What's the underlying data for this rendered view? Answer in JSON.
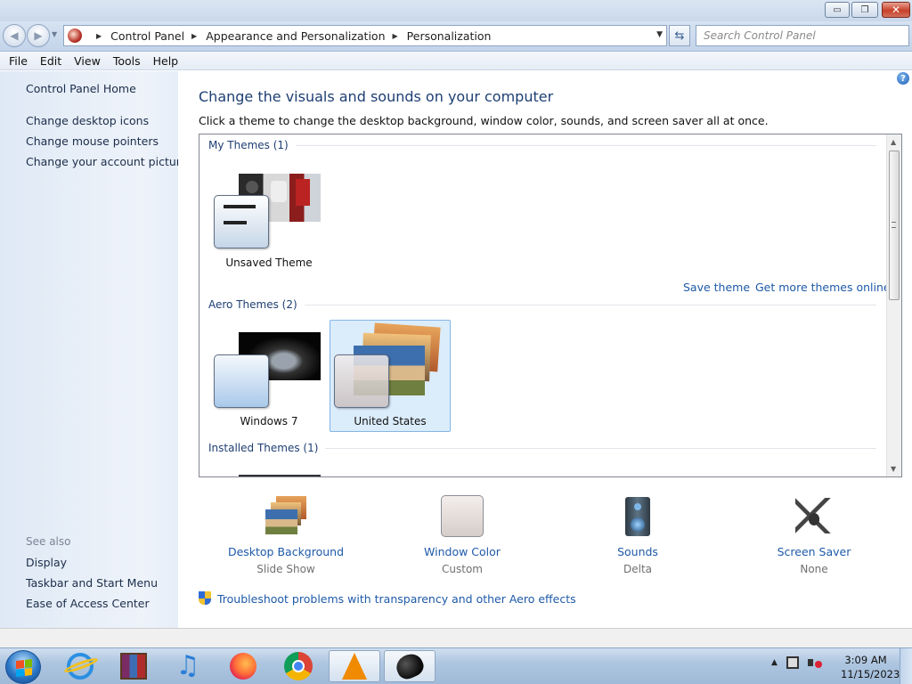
{
  "window": {
    "minimize_glyph": "▭",
    "maximize_glyph": "❐",
    "close_glyph": "✕"
  },
  "address_bar": {
    "breadcrumbs": [
      "Control Panel",
      "Appearance and Personalization",
      "Personalization"
    ],
    "search_placeholder": "Search Control Panel"
  },
  "menu": [
    "File",
    "Edit",
    "View",
    "Tools",
    "Help"
  ],
  "left_pane": {
    "home_link": "Control Panel Home",
    "tasks": [
      "Change desktop icons",
      "Change mouse pointers",
      "Change your account picture"
    ],
    "see_also_heading": "See also",
    "see_also": [
      "Display",
      "Taskbar and Start Menu",
      "Ease of Access Center"
    ]
  },
  "main": {
    "title": "Change the visuals and sounds on your computer",
    "subtitle": "Click a theme to change the desktop background, window color, sounds, and screen saver all at once.",
    "help_glyph": "?",
    "my_themes_heading": "My Themes (1)",
    "unsaved_theme_label": "Unsaved Theme",
    "save_theme_link": "Save theme",
    "get_more_link": "Get more themes online",
    "aero_heading": "Aero Themes (2)",
    "aero_themes": [
      "Windows 7",
      "United States"
    ],
    "selected_theme": "United States",
    "installed_heading": "Installed Themes (1)"
  },
  "settings": [
    {
      "name": "Desktop Background",
      "value": "Slide Show"
    },
    {
      "name": "Window Color",
      "value": "Custom"
    },
    {
      "name": "Sounds",
      "value": "Delta"
    },
    {
      "name": "Screen Saver",
      "value": "None"
    }
  ],
  "troubleshoot_link": "Troubleshoot problems with transparency and other Aero effects",
  "taskbar": {
    "apps": [
      "internet-explorer",
      "winrar",
      "itunes",
      "firefox",
      "chrome",
      "vlc",
      "black-app"
    ],
    "active_apps": [
      "vlc",
      "black-app"
    ],
    "time": "3:09 AM",
    "date": "11/15/2023",
    "colors": {
      "start_orb": "#2b78c6",
      "taskbar": "#aec6e0"
    }
  }
}
